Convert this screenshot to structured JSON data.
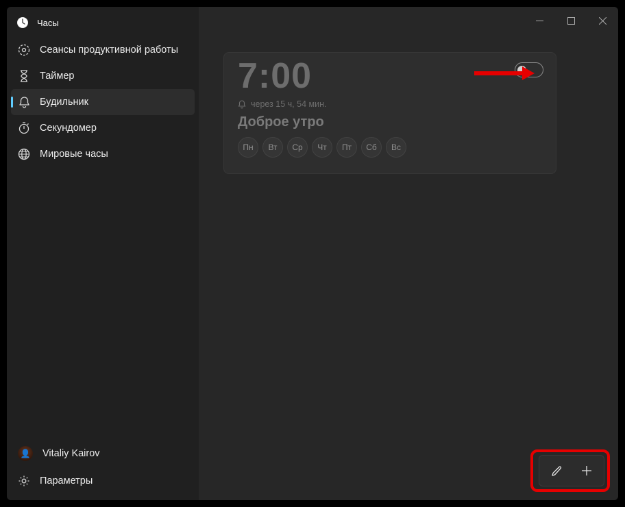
{
  "app": {
    "title": "Часы"
  },
  "sidebar": {
    "items": [
      {
        "label": "Сеансы продуктивной работы",
        "icon": "focus-icon",
        "selected": false
      },
      {
        "label": "Таймер",
        "icon": "timer-icon",
        "selected": false
      },
      {
        "label": "Будильник",
        "icon": "alarm-icon",
        "selected": true
      },
      {
        "label": "Секундомер",
        "icon": "stopwatch-icon",
        "selected": false
      },
      {
        "label": "Мировые часы",
        "icon": "world-clock-icon",
        "selected": false
      }
    ]
  },
  "footer": {
    "user": "Vitaliy Kairov",
    "settings": "Параметры"
  },
  "alarm": {
    "time": "7:00",
    "status": "через 15 ч, 54 мин.",
    "label": "Доброе утро",
    "days": [
      "Пн",
      "Вт",
      "Ср",
      "Чт",
      "Пт",
      "Сб",
      "Вс"
    ],
    "enabled": false
  },
  "colors": {
    "accent": "#60cdff",
    "annotation": "#e60000"
  }
}
